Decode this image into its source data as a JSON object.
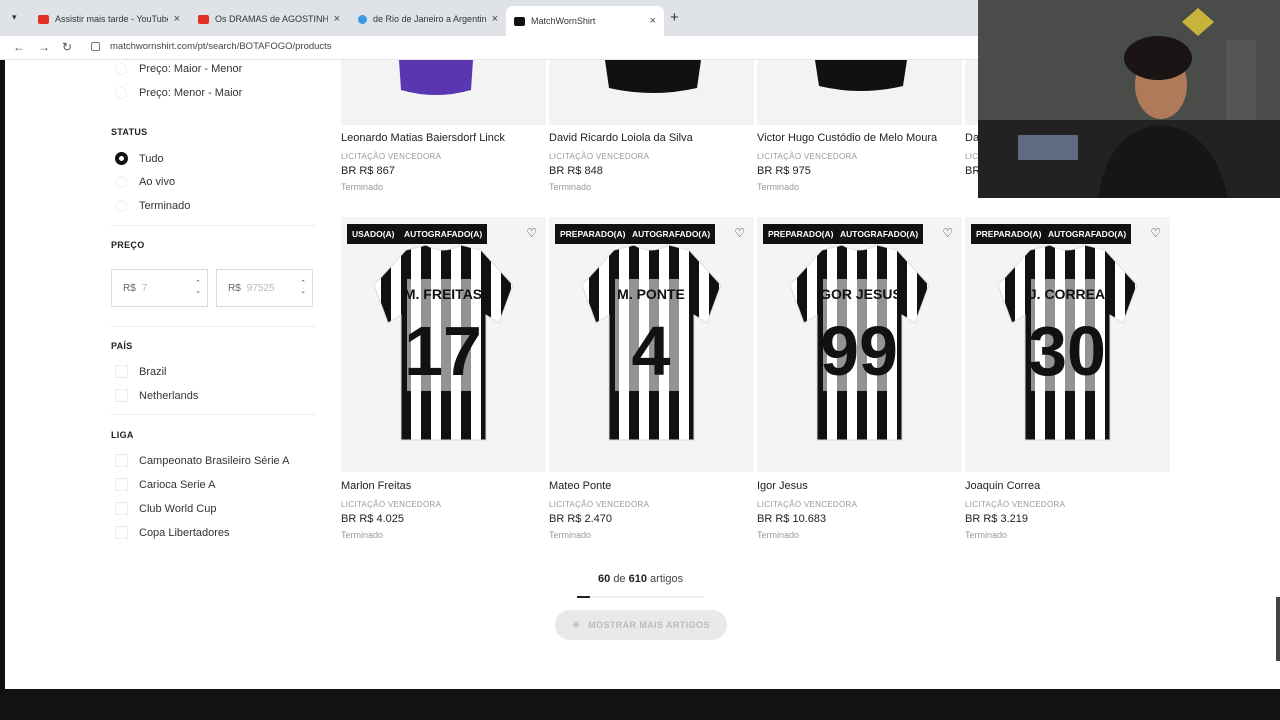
{
  "browser": {
    "tabs": [
      {
        "title": "Assistir mais tarde - YouTube",
        "icon": "youtube-icon"
      },
      {
        "title": "Os DRAMAS de AGOSTINHO C",
        "icon": "youtube-icon"
      },
      {
        "title": "de Rio de Janeiro a Argentina |",
        "icon": "globe-icon"
      },
      {
        "title": "MatchWornShirt",
        "icon": "matchwornshirt-icon"
      }
    ],
    "url": "matchwornshirt.com/pt/search/BOTAFOGO/products",
    "new_tab": "+",
    "close": "×"
  },
  "filters": {
    "sort_options": [
      "Preço: Maior - Menor",
      "Preço: Menor - Maior"
    ],
    "status": {
      "heading": "STATUS",
      "options": [
        "Tudo",
        "Ao vivo",
        "Terminado"
      ],
      "selected": "Tudo"
    },
    "price": {
      "heading": "PREÇO",
      "currency": "R$",
      "min_placeholder": "7",
      "max_placeholder": "97525"
    },
    "country": {
      "heading": "PAÍS",
      "options": [
        "Brazil",
        "Netherlands"
      ]
    },
    "league": {
      "heading": "LIGA",
      "options": [
        "Campeonato Brasileiro Série A",
        "Carioca Serie A",
        "Club World Cup",
        "Copa Libertadores"
      ]
    }
  },
  "top_products": [
    {
      "name": "Leonardo Matias Baiersdorf Linck",
      "sub": "LICITAÇÃO VENCEDORA",
      "price": "BR R$ 867",
      "status": "Terminado"
    },
    {
      "name": "David Ricardo Loiola da Silva",
      "sub": "LICITAÇÃO VENCEDORA",
      "price": "BR R$ 848",
      "status": "Terminado"
    },
    {
      "name": "Victor Hugo Custódio de Melo Moura",
      "sub": "LICITAÇÃO VENCEDORA",
      "price": "BR R$ 975",
      "status": "Terminado"
    },
    {
      "name": "Da",
      "sub": "LIC",
      "price": "BR",
      "status": ""
    }
  ],
  "products": [
    {
      "badges": [
        "USADO(A)",
        "AUTOGRAFADO(A)"
      ],
      "shirt_name": "M. FREITAS",
      "shirt_number": "17",
      "name": "Marlon Freitas",
      "sub": "LICITAÇÃO VENCEDORA",
      "price": "BR R$ 4.025",
      "status": "Terminado"
    },
    {
      "badges": [
        "PREPARADO(A)",
        "AUTOGRAFADO(A)"
      ],
      "shirt_name": "M. PONTE",
      "shirt_number": "4",
      "name": "Mateo Ponte",
      "sub": "LICITAÇÃO VENCEDORA",
      "price": "BR R$ 2.470",
      "status": "Terminado"
    },
    {
      "badges": [
        "PREPARADO(A)",
        "AUTOGRAFADO(A)"
      ],
      "shirt_name": "IGOR JESUS",
      "shirt_number": "99",
      "name": "Igor Jesus",
      "sub": "LICITAÇÃO VENCEDORA",
      "price": "BR R$ 10.683",
      "status": "Terminado"
    },
    {
      "badges": [
        "PREPARADO(A)",
        "AUTOGRAFADO(A)"
      ],
      "shirt_name": "J. CORREA",
      "shirt_number": "30",
      "name": "Joaquin Correa",
      "sub": "LICITAÇÃO VENCEDORA",
      "price": "BR R$ 3.219",
      "status": "Terminado"
    }
  ],
  "pagination": {
    "shown": "60",
    "de": "de",
    "total": "610",
    "artigos": "artigos",
    "progress": 0.1,
    "button": "MOSTRAR MAIS ARTIGOS"
  },
  "colors": {
    "accent": "#111111",
    "badge_bg": "#111111",
    "muted": "#999999"
  }
}
